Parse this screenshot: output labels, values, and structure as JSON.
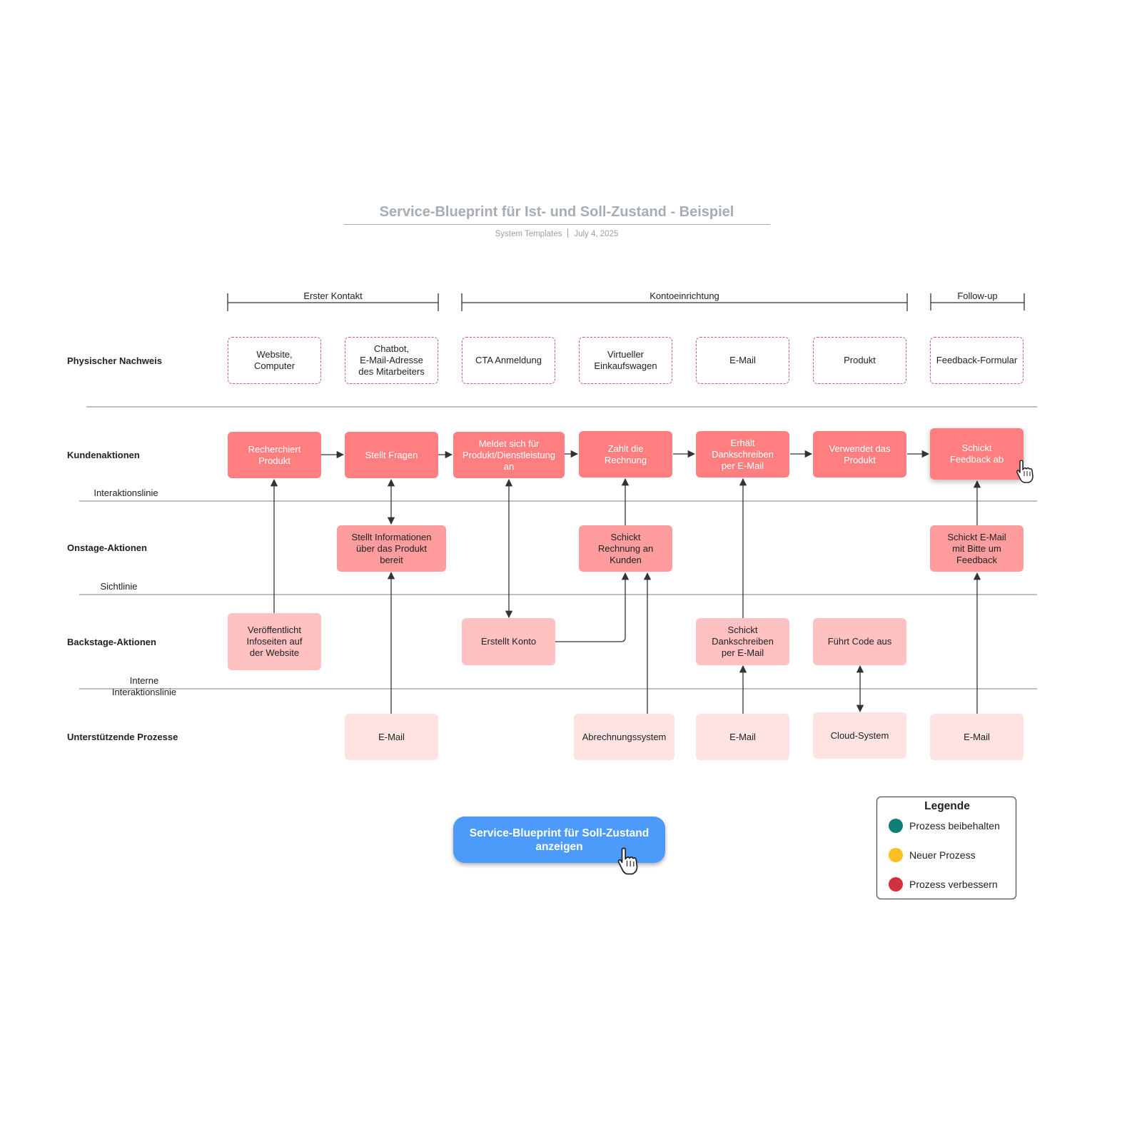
{
  "header": {
    "title": "Service-Blueprint für Ist- und Soll-Zustand - Beispiel",
    "author": "System Templates",
    "date": "July 4, 2025"
  },
  "phases": [
    {
      "label": "Erster Kontakt"
    },
    {
      "label": "Kontoeinrichtung"
    },
    {
      "label": "Follow-up"
    }
  ],
  "rows": {
    "evidence": "Physischer Nachweis",
    "customer": "Kundenaktionen",
    "onstage": "Onstage-Aktionen",
    "backstage": "Backstage-Aktionen",
    "support": "Unterstützende Prozesse"
  },
  "lines": {
    "interaction": "Interaktionslinie",
    "visibility": "Sichtlinie",
    "internal": "Interne\nInteraktionslinie"
  },
  "evidence": [
    "Website,\nComputer",
    "Chatbot,\nE-Mail-Adresse\ndes Mitarbeiters",
    "CTA Anmeldung",
    "Virtueller\nEinkaufswagen",
    "E-Mail",
    "Produkt",
    "Feedback-Formular"
  ],
  "customer_actions": [
    "Recherchiert\nProdukt",
    "Stellt Fragen",
    "Meldet sich für\nProdukt/Dienstleistung\nan",
    "Zahlt die\nRechnung",
    "Erhält\nDankschreiben\nper E-Mail",
    "Verwendet das\nProdukt",
    "Schickt\nFeedback ab"
  ],
  "onstage_actions": [
    {
      "col": 1,
      "text": "Stellt Informationen\nüber das Produkt\nbereit"
    },
    {
      "col": 3,
      "text": "Schickt\nRechnung an\nKunden"
    },
    {
      "col": 6,
      "text": "Schickt E-Mail\nmit Bitte um\nFeedback"
    }
  ],
  "backstage_actions": [
    {
      "col": 0,
      "text": "Veröffentlicht\nInfoseiten auf\nder Website"
    },
    {
      "col": 2,
      "text": "Erstellt Konto"
    },
    {
      "col": 4,
      "text": "Schickt\nDankschreiben\nper E-Mail"
    },
    {
      "col": 5,
      "text": "Führt Code aus"
    }
  ],
  "support_processes": [
    {
      "col": 1,
      "text": "E-Mail"
    },
    {
      "col": 3,
      "text": "Abrechnungssystem"
    },
    {
      "col": 4,
      "text": "E-Mail"
    },
    {
      "col": 5,
      "text": "Cloud-System"
    },
    {
      "col": 6,
      "text": "E-Mail"
    }
  ],
  "cta": {
    "label": "Service-Blueprint für Soll-Zustand anzeigen"
  },
  "legend": {
    "title": "Legende",
    "items": [
      {
        "label": "Prozess beibehalten",
        "color": "#0f7f78"
      },
      {
        "label": "Neuer Prozess",
        "color": "#fbbf24"
      },
      {
        "label": "Prozess verbessern",
        "color": "#d2303a"
      }
    ]
  },
  "colors": {
    "evidence_border": "#e0575a",
    "customer": "#ff7f80",
    "onstage": "#ff9d9e",
    "backstage": "#ffc1c2",
    "support": "#ffe3e3",
    "cta": "#4c9bfb"
  }
}
